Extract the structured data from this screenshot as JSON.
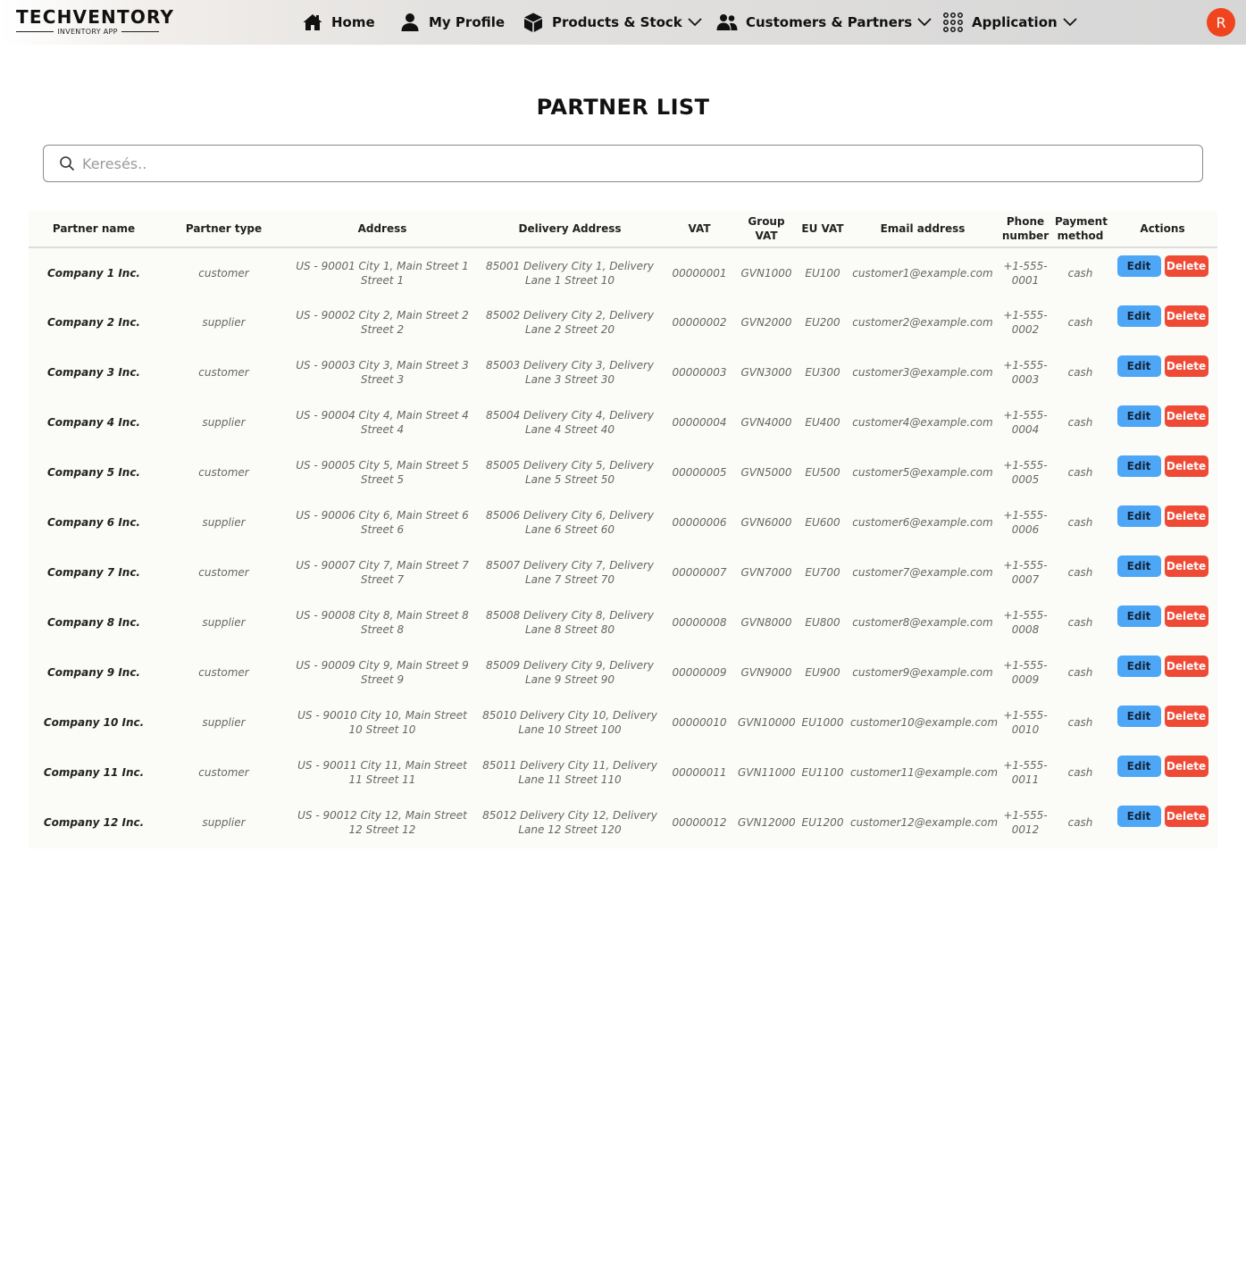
{
  "brand": {
    "title": "TECHVENTORY",
    "subtitle": "INVENTORY APP"
  },
  "nav": {
    "home": "Home",
    "profile": "My Profile",
    "products": "Products & Stock",
    "customers": "Customers & Partners",
    "application": "Application",
    "avatar_initial": "R"
  },
  "page": {
    "title": "PARTNER LIST"
  },
  "search": {
    "placeholder": "Keresés.."
  },
  "table": {
    "headers": [
      "Partner name",
      "Partner type",
      "Address",
      "Delivery Address",
      "VAT",
      "Group VAT",
      "EU VAT",
      "Email address",
      "Phone number",
      "Payment method",
      "Actions"
    ],
    "edit_label": "Edit",
    "delete_label": "Delete",
    "rows": [
      {
        "name": "Company 1 Inc.",
        "type": "customer",
        "address": "US - 90001 City 1, Main Street 1 Street 1",
        "delivery": "85001 Delivery City 1, Delivery Lane 1 Street 10",
        "vat": "00000001",
        "group_vat": "GVN1000",
        "eu_vat": "EU100",
        "email": "customer1@example.com",
        "phone": "+1-555-0001",
        "payment": "cash"
      },
      {
        "name": "Company 2 Inc.",
        "type": "supplier",
        "address": "US - 90002 City 2, Main Street 2 Street 2",
        "delivery": "85002 Delivery City 2, Delivery Lane 2 Street 20",
        "vat": "00000002",
        "group_vat": "GVN2000",
        "eu_vat": "EU200",
        "email": "customer2@example.com",
        "phone": "+1-555-0002",
        "payment": "cash"
      },
      {
        "name": "Company 3 Inc.",
        "type": "customer",
        "address": "US - 90003 City 3, Main Street 3 Street 3",
        "delivery": "85003 Delivery City 3, Delivery Lane 3 Street 30",
        "vat": "00000003",
        "group_vat": "GVN3000",
        "eu_vat": "EU300",
        "email": "customer3@example.com",
        "phone": "+1-555-0003",
        "payment": "cash"
      },
      {
        "name": "Company 4 Inc.",
        "type": "supplier",
        "address": "US - 90004 City 4, Main Street 4 Street 4",
        "delivery": "85004 Delivery City 4, Delivery Lane 4 Street 40",
        "vat": "00000004",
        "group_vat": "GVN4000",
        "eu_vat": "EU400",
        "email": "customer4@example.com",
        "phone": "+1-555-0004",
        "payment": "cash"
      },
      {
        "name": "Company 5 Inc.",
        "type": "customer",
        "address": "US - 90005 City 5, Main Street 5 Street 5",
        "delivery": "85005 Delivery City 5, Delivery Lane 5 Street 50",
        "vat": "00000005",
        "group_vat": "GVN5000",
        "eu_vat": "EU500",
        "email": "customer5@example.com",
        "phone": "+1-555-0005",
        "payment": "cash"
      },
      {
        "name": "Company 6 Inc.",
        "type": "supplier",
        "address": "US - 90006 City 6, Main Street 6 Street 6",
        "delivery": "85006 Delivery City 6, Delivery Lane 6 Street 60",
        "vat": "00000006",
        "group_vat": "GVN6000",
        "eu_vat": "EU600",
        "email": "customer6@example.com",
        "phone": "+1-555-0006",
        "payment": "cash"
      },
      {
        "name": "Company 7 Inc.",
        "type": "customer",
        "address": "US - 90007 City 7, Main Street 7 Street 7",
        "delivery": "85007 Delivery City 7, Delivery Lane 7 Street 70",
        "vat": "00000007",
        "group_vat": "GVN7000",
        "eu_vat": "EU700",
        "email": "customer7@example.com",
        "phone": "+1-555-0007",
        "payment": "cash"
      },
      {
        "name": "Company 8 Inc.",
        "type": "supplier",
        "address": "US - 90008 City 8, Main Street 8 Street 8",
        "delivery": "85008 Delivery City 8, Delivery Lane 8 Street 80",
        "vat": "00000008",
        "group_vat": "GVN8000",
        "eu_vat": "EU800",
        "email": "customer8@example.com",
        "phone": "+1-555-0008",
        "payment": "cash"
      },
      {
        "name": "Company 9 Inc.",
        "type": "customer",
        "address": "US - 90009 City 9, Main Street 9 Street 9",
        "delivery": "85009 Delivery City 9, Delivery Lane 9 Street 90",
        "vat": "00000009",
        "group_vat": "GVN9000",
        "eu_vat": "EU900",
        "email": "customer9@example.com",
        "phone": "+1-555-0009",
        "payment": "cash"
      },
      {
        "name": "Company 10 Inc.",
        "type": "supplier",
        "address": "US - 90010 City 10, Main Street 10 Street 10",
        "delivery": "85010 Delivery City 10, Delivery Lane 10 Street 100",
        "vat": "00000010",
        "group_vat": "GVN10000",
        "eu_vat": "EU1000",
        "email": "customer10@example.com",
        "phone": "+1-555-0010",
        "payment": "cash"
      },
      {
        "name": "Company 11 Inc.",
        "type": "customer",
        "address": "US - 90011 City 11, Main Street 11 Street 11",
        "delivery": "85011 Delivery City 11, Delivery Lane 11 Street 110",
        "vat": "00000011",
        "group_vat": "GVN11000",
        "eu_vat": "EU1100",
        "email": "customer11@example.com",
        "phone": "+1-555-0011",
        "payment": "cash"
      },
      {
        "name": "Company 12 Inc.",
        "type": "supplier",
        "address": "US - 90012 City 12, Main Street 12 Street 12",
        "delivery": "85012 Delivery City 12, Delivery Lane 12 Street 120",
        "vat": "00000012",
        "group_vat": "GVN12000",
        "eu_vat": "EU1200",
        "email": "customer12@example.com",
        "phone": "+1-555-0012",
        "payment": "cash"
      }
    ]
  },
  "colors": {
    "avatar": "#f0441e",
    "edit_button": "#4ea7f6",
    "delete_button": "#ef4a36"
  },
  "icons": {
    "home": "home-icon",
    "profile": "user-icon",
    "products": "box-icon",
    "customers": "users-icon",
    "application": "grid-icon",
    "search": "search-icon",
    "dropdown": "chevron-down-icon"
  }
}
